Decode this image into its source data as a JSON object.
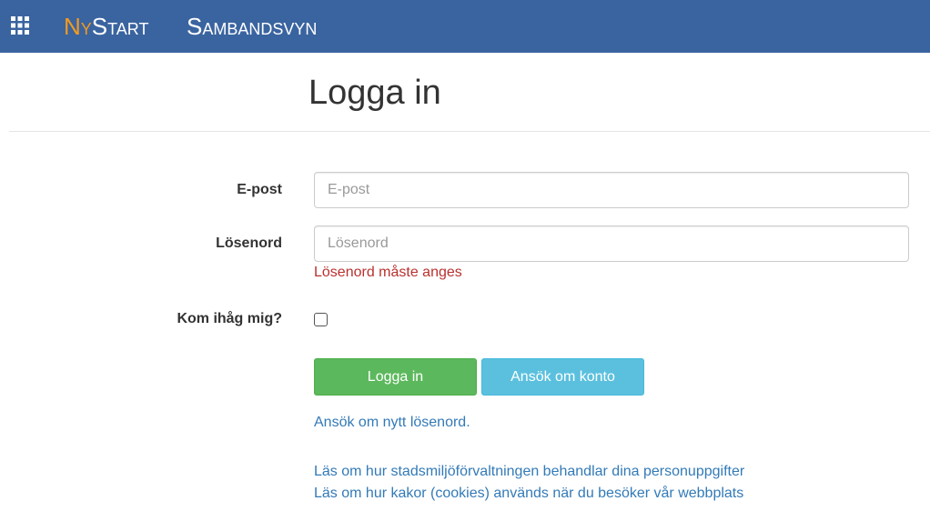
{
  "navbar": {
    "apps_icon": "grid-icon",
    "brand_first": "Ny",
    "brand_second": "Start",
    "nav_link": "Sambandsvyn",
    "colors": {
      "background": "#3a64a0",
      "brand_accent": "#f39a1f",
      "text": "#ffffff"
    }
  },
  "page": {
    "title": "Logga in"
  },
  "form": {
    "email": {
      "label": "E-post",
      "placeholder": "E-post",
      "value": ""
    },
    "password": {
      "label": "Lösenord",
      "placeholder": "Lösenord",
      "value": "",
      "error": "Lösenord måste anges"
    },
    "remember": {
      "label": "Kom ihåg mig?",
      "checked": false
    },
    "buttons": {
      "login": "Logga in",
      "apply": "Ansök om konto"
    },
    "forgot_password_link": "Ansök om nytt lösenord."
  },
  "footer_links": {
    "privacy": "Läs om hur stadsmiljöförvaltningen behandlar dina personuppgifter",
    "cookies": "Läs om hur kakor (cookies) används när du besöker vår webbplats"
  },
  "colors": {
    "success": "#5cb85c",
    "info": "#5bc0de",
    "error": "#b9312f",
    "link": "#337ab7"
  }
}
